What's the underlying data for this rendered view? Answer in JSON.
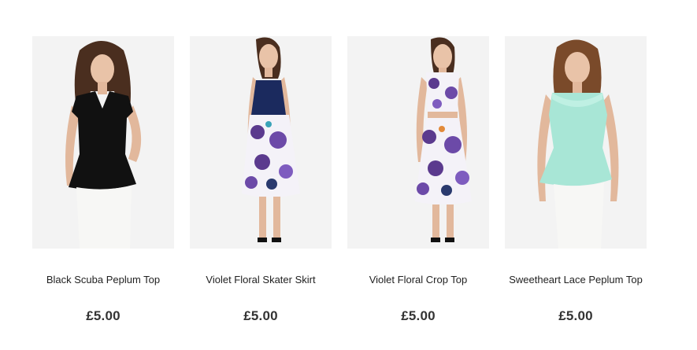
{
  "products": [
    {
      "name": "Black Scuba Peplum Top",
      "price": "£5.00",
      "image": "model-black-peplum-top-image"
    },
    {
      "name": "Violet Floral Skater Skirt",
      "price": "£5.00",
      "image": "model-violet-floral-skirt-image"
    },
    {
      "name": "Violet Floral Crop Top",
      "price": "£5.00",
      "image": "model-violet-floral-crop-top-image"
    },
    {
      "name": "Sweetheart Lace Peplum Top",
      "price": "£5.00",
      "image": "model-mint-lace-peplum-top-image"
    }
  ],
  "colors": {
    "image_background": "#f3f3f3",
    "black_top": "#111111",
    "navy_cami": "#1b2a5e",
    "floral_violet": "#5b3a8e",
    "mint_lace": "#a8e6d6",
    "white_skirt": "#f7f7f5"
  }
}
